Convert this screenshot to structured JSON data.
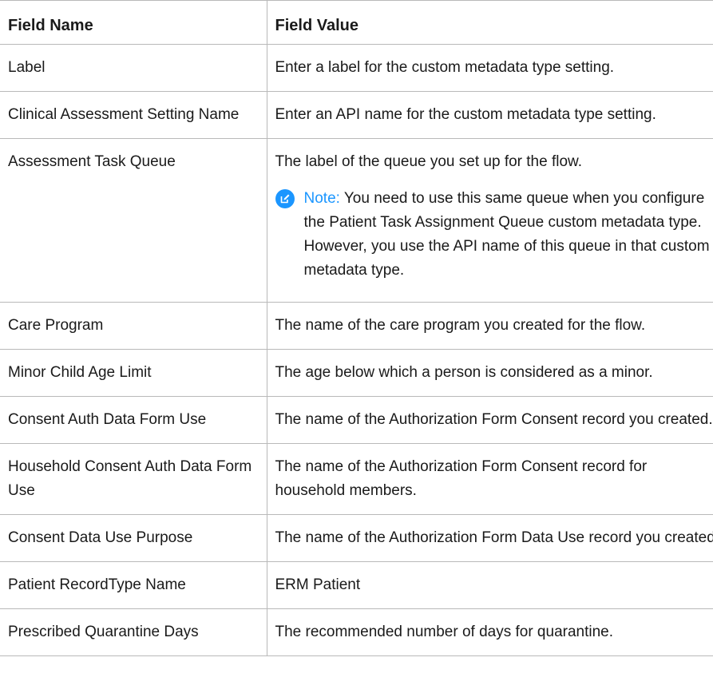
{
  "table": {
    "headers": [
      "Field Name",
      "Field Value"
    ],
    "rows": [
      {
        "name": "Label",
        "value": "Enter a label for the custom metadata type setting."
      },
      {
        "name": "Clinical Assessment Setting Name",
        "value": "Enter an API name for the custom metadata type setting."
      },
      {
        "name": "Assessment Task Queue",
        "value": "The label of the queue you set up for the flow.",
        "note_label": "Note:",
        "note_text": "You need to use this same queue when you configure the Patient Task Assignment Queue custom metadata type. However, you use the API name of this queue in that custom metadata type."
      },
      {
        "name": "Care Program",
        "value": "The name of the care program you created for the flow."
      },
      {
        "name": "Minor Child Age Limit",
        "value": "The age below which a person is considered as a minor."
      },
      {
        "name": "Consent Auth Data Form Use",
        "value": "The name of the Authorization Form Consent record you created."
      },
      {
        "name": "Household Consent Auth Data Form Use",
        "value": "The name of the Authorization Form Consent record for household members."
      },
      {
        "name": "Consent Data Use Purpose",
        "value": "The name of the Authorization Form Data Use record you created."
      },
      {
        "name": "Patient RecordType Name",
        "value": "ERM Patient"
      },
      {
        "name": "Prescribed Quarantine Days",
        "value": "The recommended number of days for quarantine."
      }
    ]
  },
  "colors": {
    "note_accent": "#1b96ff",
    "border": "#b9b9b9"
  },
  "icons": {
    "note": "edit-note-icon"
  }
}
